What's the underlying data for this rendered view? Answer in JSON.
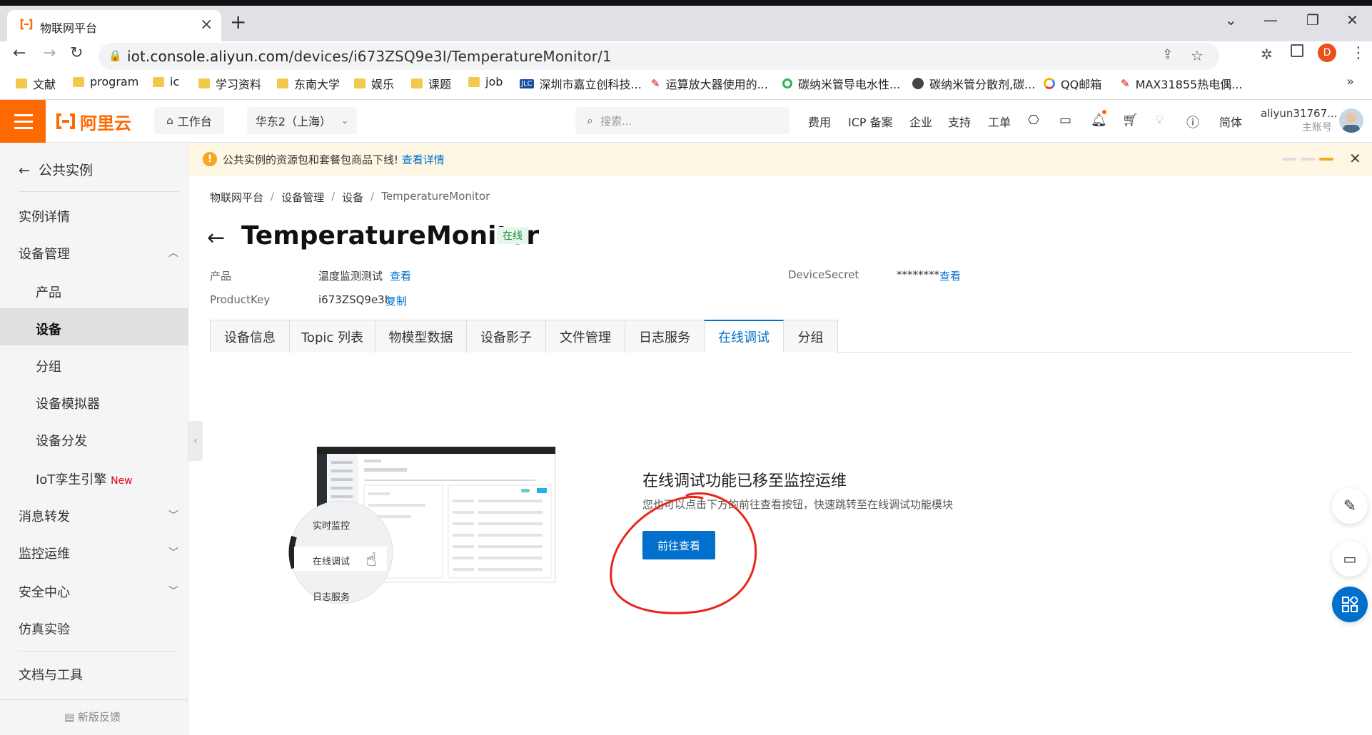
{
  "browser": {
    "tab_title": "物联网平台",
    "url_host": "iot.console.aliyun.com",
    "url_path": "/devices/i673ZSQ9e3I/TemperatureMonitor/1",
    "bookmarks": [
      "文献",
      "program",
      "ic",
      "学习资料",
      "东南大学",
      "娱乐",
      "课题",
      "job",
      "深圳市嘉立创科技...",
      "运算放大器使用的...",
      "碳纳米管导电水性...",
      "碳纳米管分散剂,碳...",
      "QQ邮箱",
      "MAX31855热电偶..."
    ],
    "profile_initial": "D"
  },
  "header": {
    "logo_text": "阿里云",
    "workbench": "工作台",
    "region": "华东2（上海）",
    "search_placeholder": "搜索...",
    "nav": [
      "费用",
      "ICP 备案",
      "企业",
      "支持",
      "工单"
    ],
    "lang": "简体",
    "account_name": "aliyun31767...",
    "account_type": "主账号"
  },
  "sidebar": {
    "back_label": "公共实例",
    "items": {
      "instance_detail": "实例详情",
      "device_mgmt": "设备管理",
      "product": "产品",
      "device": "设备",
      "group": "分组",
      "simulator": "设备模拟器",
      "distribute": "设备分发",
      "twin": "IoT孪生引擎",
      "twin_badge": "New",
      "msg_forward": "消息转发",
      "monitor_ops": "监控运维",
      "security": "安全中心",
      "simulation": "仿真实验",
      "docs_tools": "文档与工具"
    },
    "feedback": "新版反馈"
  },
  "notice": {
    "text": "公共实例的资源包和套餐包商品下线!",
    "link": "查看详情"
  },
  "breadcrumb": [
    "物联网平台",
    "设备管理",
    "设备",
    "TemperatureMonitor"
  ],
  "device": {
    "name": "TemperatureMonitor",
    "status": "在线",
    "product_label": "产品",
    "product_value": "温度监测测试",
    "product_action": "查看",
    "pk_label": "ProductKey",
    "pk_value": "i673ZSQ9e3I",
    "pk_action": "复制",
    "secret_label": "DeviceSecret",
    "secret_value": "********",
    "secret_action": "查看"
  },
  "tabs": [
    "设备信息",
    "Topic 列表",
    "物模型数据",
    "设备影子",
    "文件管理",
    "日志服务",
    "在线调试",
    "分组"
  ],
  "active_tab": "在线调试",
  "moved": {
    "title": "在线调试功能已移至监控运维",
    "desc": "您也可以点击下方的前往查看按钮，快速跳转至在线调试功能模块",
    "button": "前往查看"
  },
  "illustration": {
    "menu": [
      "实时监控",
      "在线调试",
      "日志服务"
    ]
  },
  "colors": {
    "brand": "#ff6a00",
    "primary": "#0070cc",
    "annotation": "#e8261c"
  }
}
